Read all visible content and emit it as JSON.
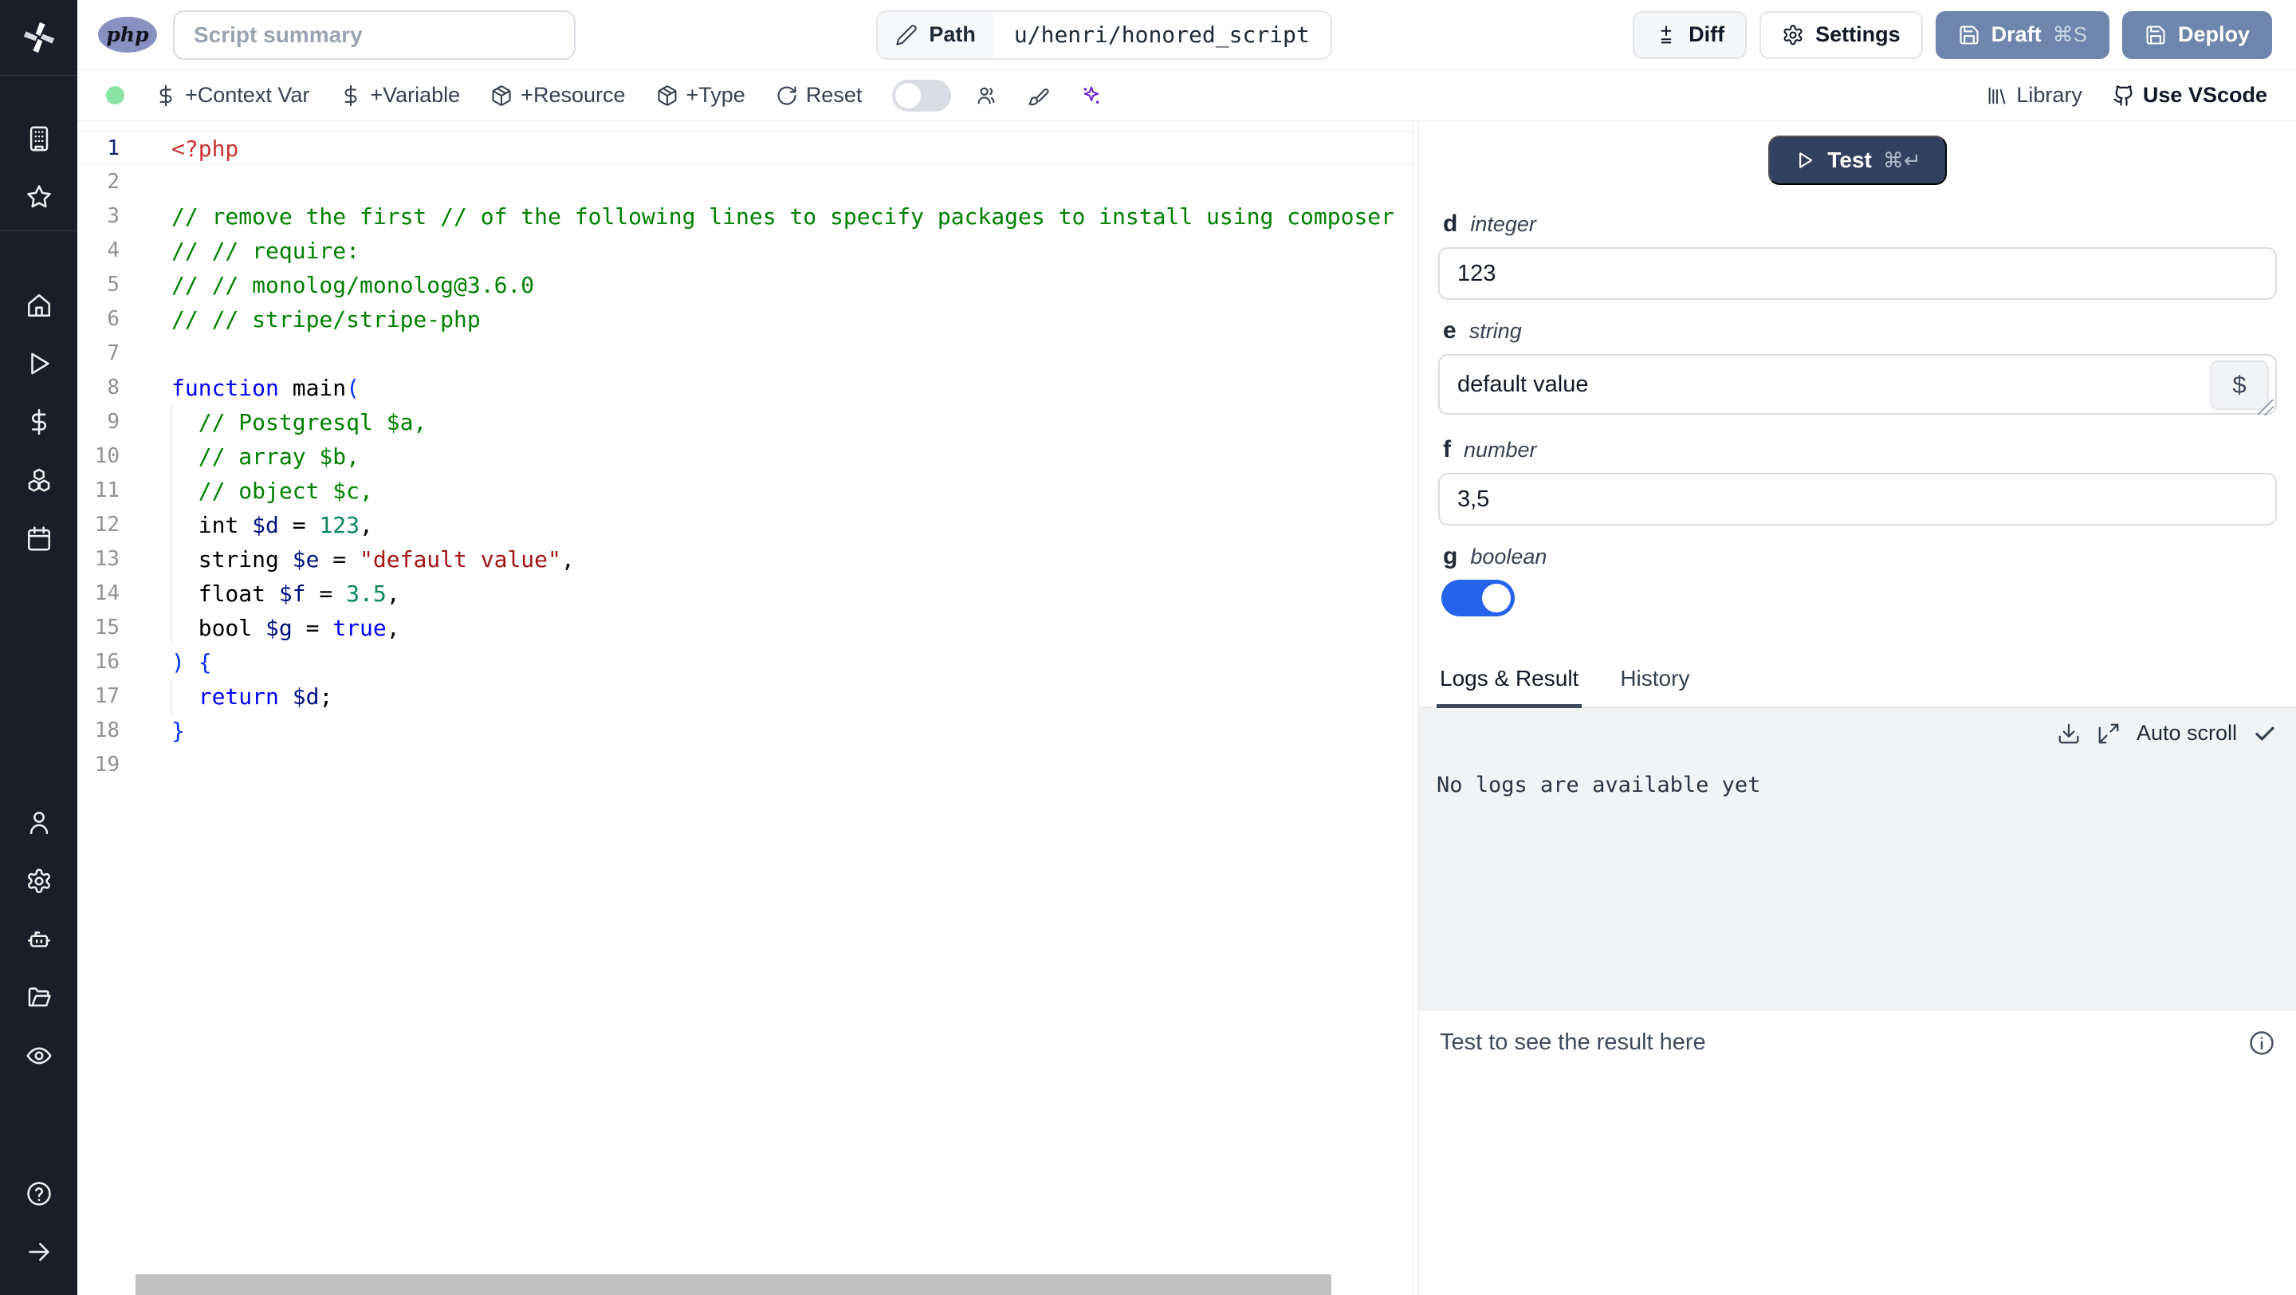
{
  "topbar": {
    "language_badge": "php",
    "summary_placeholder": "Script summary",
    "path_label": "Path",
    "path_value": "u/henri/honored_script",
    "diff_label": "Diff",
    "settings_label": "Settings",
    "draft_label": "Draft",
    "draft_shortcut": "⌘S",
    "deploy_label": "Deploy"
  },
  "toolbar": {
    "status_color": "#8be3a4",
    "add_context_var": "+Context Var",
    "add_variable": "+Variable",
    "add_resource": "+Resource",
    "add_type": "+Type",
    "reset": "Reset",
    "library": "Library",
    "use_vscode": "Use VScode"
  },
  "editor": {
    "language": "php",
    "lines": [
      {
        "n": 1,
        "active": true,
        "tokens": [
          {
            "t": "<?php",
            "c": "t"
          }
        ]
      },
      {
        "n": 2,
        "tokens": []
      },
      {
        "n": 3,
        "tokens": [
          {
            "t": "// remove the first // of the following lines to specify packages to install using composer",
            "c": "c"
          }
        ]
      },
      {
        "n": 4,
        "tokens": [
          {
            "t": "// // require:",
            "c": "c"
          }
        ]
      },
      {
        "n": 5,
        "tokens": [
          {
            "t": "// // monolog/monolog@3.6.0",
            "c": "c"
          }
        ]
      },
      {
        "n": 6,
        "tokens": [
          {
            "t": "// // stripe/stripe-php",
            "c": "c"
          }
        ]
      },
      {
        "n": 7,
        "tokens": []
      },
      {
        "n": 8,
        "tokens": [
          {
            "t": "function",
            "c": "k"
          },
          {
            "t": " main",
            "c": "p"
          },
          {
            "t": "(",
            "c": "b"
          }
        ]
      },
      {
        "n": 9,
        "guide": true,
        "tokens": [
          {
            "t": "  // Postgresql $a,",
            "c": "c"
          }
        ]
      },
      {
        "n": 10,
        "guide": true,
        "tokens": [
          {
            "t": "  // array $b,",
            "c": "c"
          }
        ]
      },
      {
        "n": 11,
        "guide": true,
        "tokens": [
          {
            "t": "  // object $c,",
            "c": "c"
          }
        ]
      },
      {
        "n": 12,
        "guide": true,
        "tokens": [
          {
            "t": "  int ",
            "c": "p"
          },
          {
            "t": "$d",
            "c": "v"
          },
          {
            "t": " = ",
            "c": "p"
          },
          {
            "t": "123",
            "c": "n"
          },
          {
            "t": ",",
            "c": "p"
          }
        ]
      },
      {
        "n": 13,
        "guide": true,
        "tokens": [
          {
            "t": "  string ",
            "c": "p"
          },
          {
            "t": "$e",
            "c": "v"
          },
          {
            "t": " = ",
            "c": "p"
          },
          {
            "t": "\"default value\"",
            "c": "s"
          },
          {
            "t": ",",
            "c": "p"
          }
        ]
      },
      {
        "n": 14,
        "guide": true,
        "tokens": [
          {
            "t": "  float ",
            "c": "p"
          },
          {
            "t": "$f",
            "c": "v"
          },
          {
            "t": " = ",
            "c": "p"
          },
          {
            "t": "3.5",
            "c": "n"
          },
          {
            "t": ",",
            "c": "p"
          }
        ]
      },
      {
        "n": 15,
        "guide": true,
        "tokens": [
          {
            "t": "  bool ",
            "c": "p"
          },
          {
            "t": "$g",
            "c": "v"
          },
          {
            "t": " = ",
            "c": "p"
          },
          {
            "t": "true",
            "c": "k"
          },
          {
            "t": ",",
            "c": "p"
          }
        ]
      },
      {
        "n": 16,
        "tokens": [
          {
            "t": ") {",
            "c": "b"
          }
        ]
      },
      {
        "n": 17,
        "guide": true,
        "tokens": [
          {
            "t": "  ",
            "c": "p"
          },
          {
            "t": "return",
            "c": "k"
          },
          {
            "t": " ",
            "c": "p"
          },
          {
            "t": "$d",
            "c": "v"
          },
          {
            "t": ";",
            "c": "p"
          }
        ]
      },
      {
        "n": 18,
        "tokens": [
          {
            "t": "}",
            "c": "b"
          }
        ]
      },
      {
        "n": 19,
        "tokens": []
      }
    ]
  },
  "run_panel": {
    "test_label": "Test",
    "test_shortcut": "⌘↵",
    "fields": {
      "d": {
        "name": "d",
        "type": "integer",
        "value": "123"
      },
      "e": {
        "name": "e",
        "type": "string",
        "value": "default value",
        "action": "$"
      },
      "f": {
        "name": "f",
        "type": "number",
        "value": "3,5"
      },
      "g": {
        "name": "g",
        "type": "boolean",
        "value": true
      }
    },
    "tabs": {
      "logs": {
        "label": "Logs & Result",
        "active": true
      },
      "history": {
        "label": "History",
        "active": false
      }
    },
    "logs": {
      "auto_scroll_label": "Auto scroll",
      "empty_message": "No logs are available yet"
    },
    "result_placeholder": "Test to see the result here"
  }
}
